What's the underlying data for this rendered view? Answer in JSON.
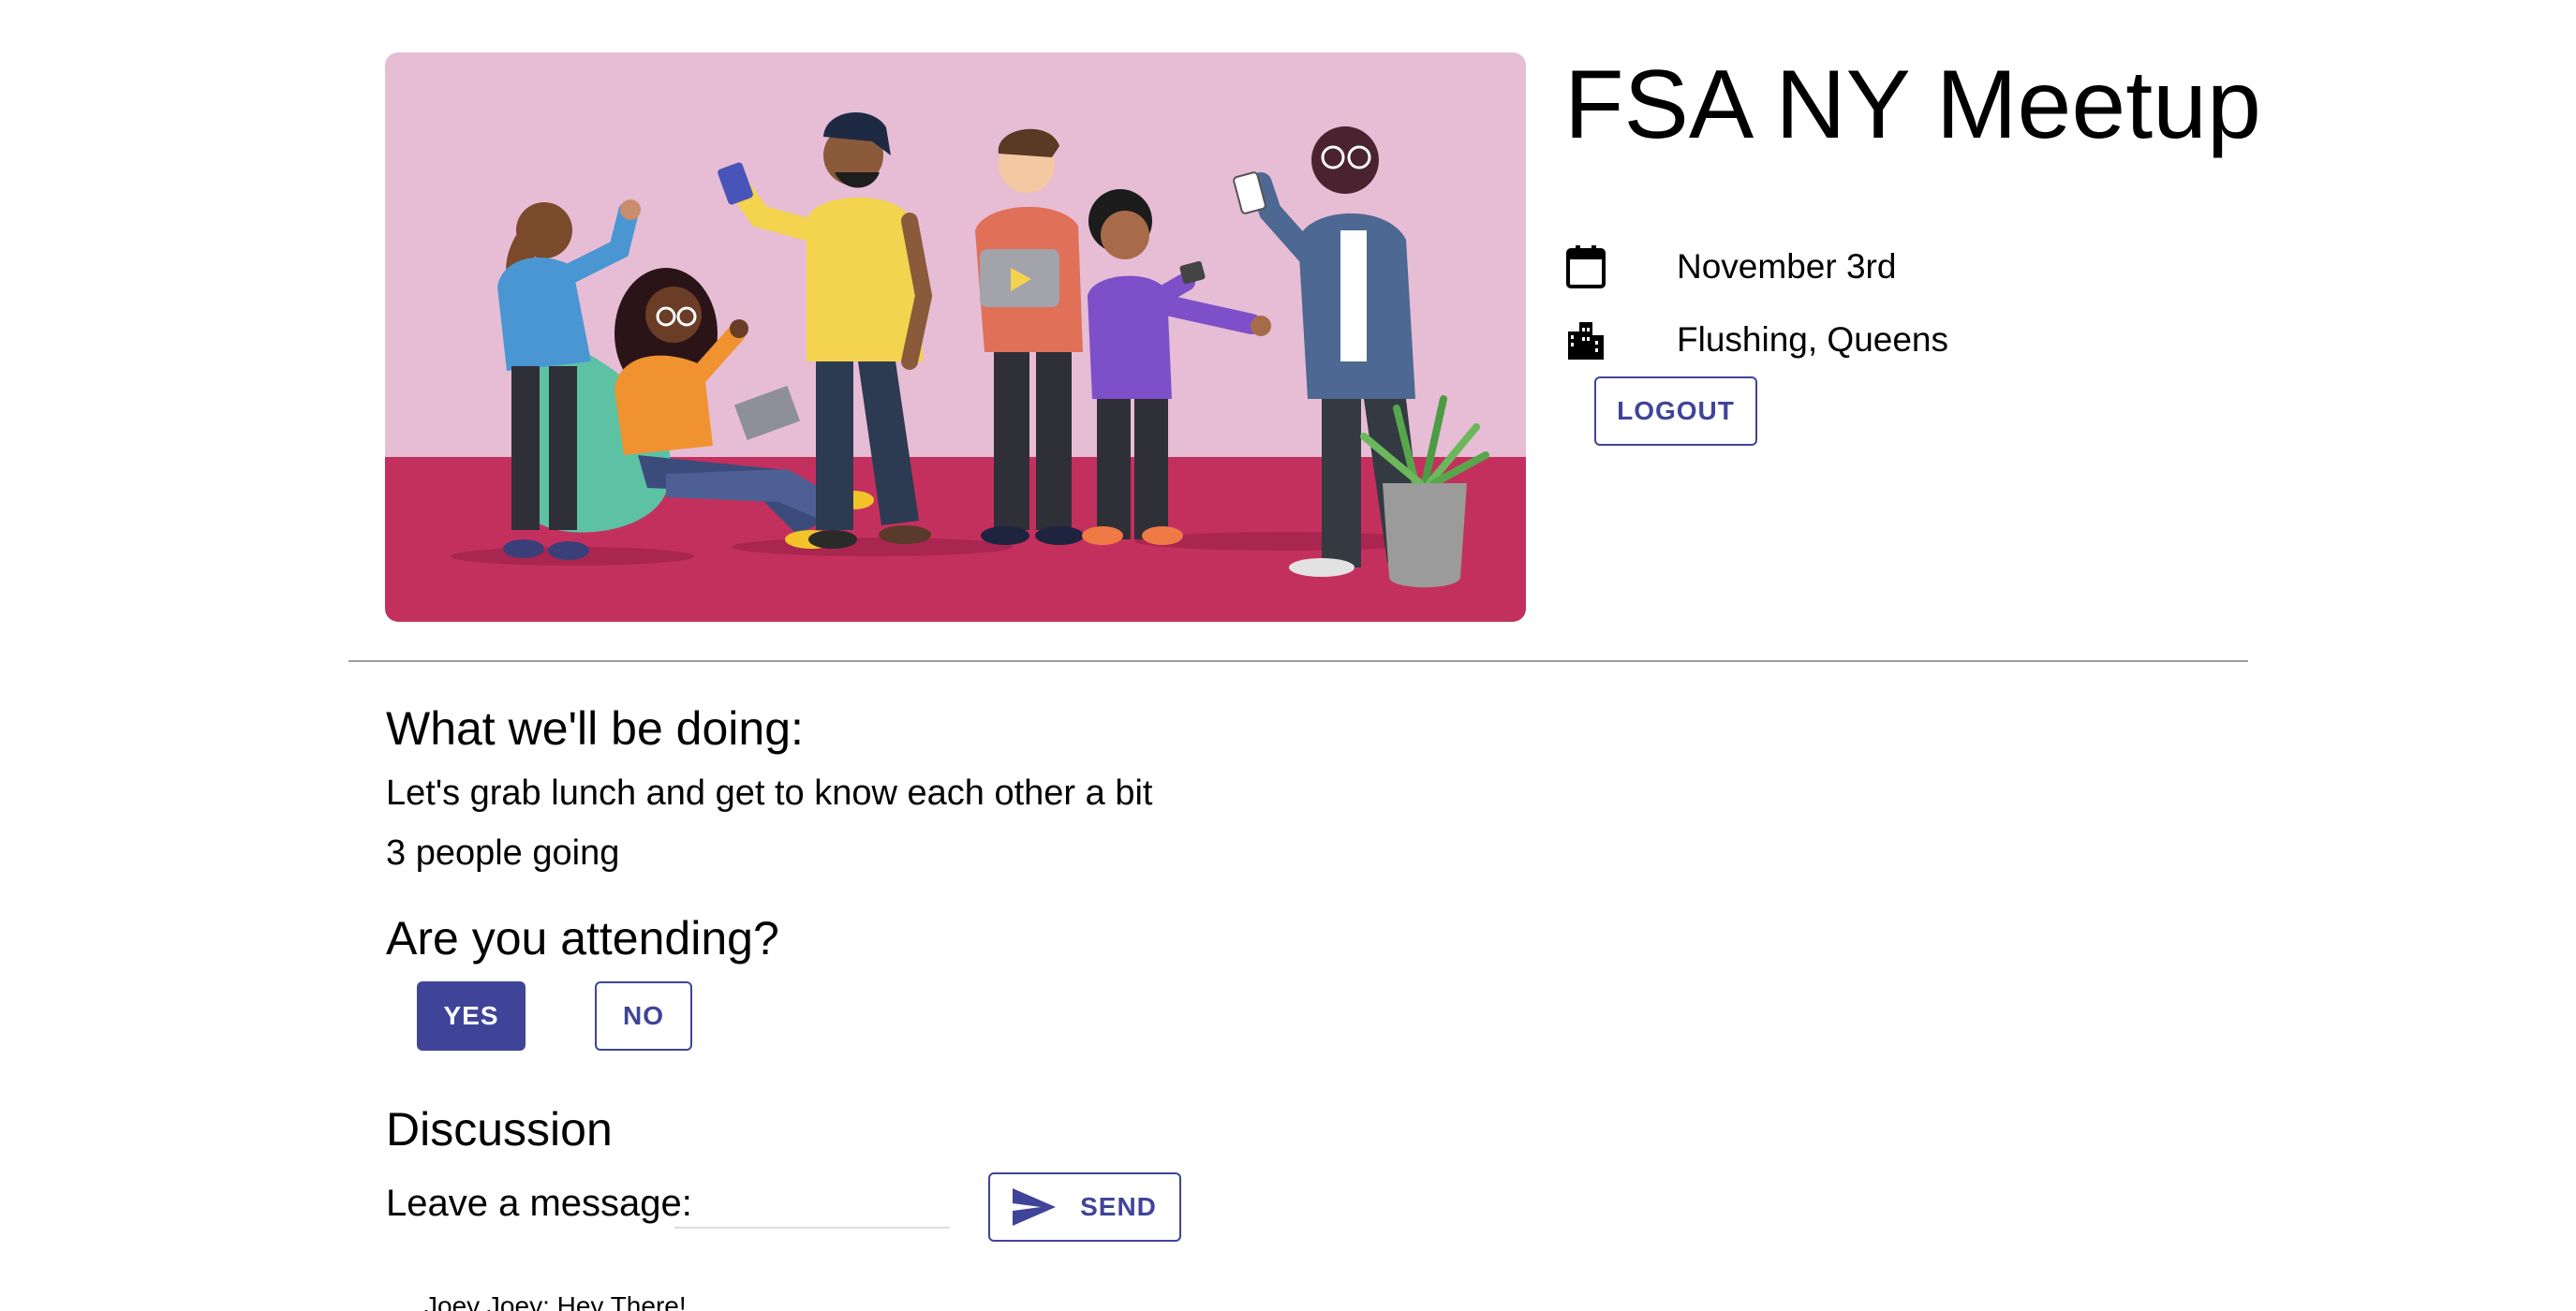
{
  "event": {
    "title": "FSA NY Meetup",
    "date": "November 3rd",
    "location": "Flushing, Queens",
    "date_icon": "calendar-icon",
    "location_icon": "city-icon"
  },
  "header": {
    "logout_label": "LOGOUT"
  },
  "details": {
    "heading": "What we'll be doing:",
    "description": "Let's grab lunch and get to know each other a bit",
    "attendance": "3 people going"
  },
  "rsvp": {
    "heading": "Are you attending?",
    "yes_label": "YES",
    "no_label": "NO"
  },
  "discussion": {
    "heading": "Discussion",
    "message_label": "Leave a message:",
    "message_value": "",
    "send_label": "SEND",
    "send_icon": "send-icon",
    "messages": [
      {
        "text": "Joey Joey: Hey There!"
      }
    ]
  },
  "colors": {
    "accent": "#3f4498",
    "hero_wall": "#e6bdd5",
    "hero_floor": "#c4305e",
    "divider": "#9e9e9e"
  }
}
